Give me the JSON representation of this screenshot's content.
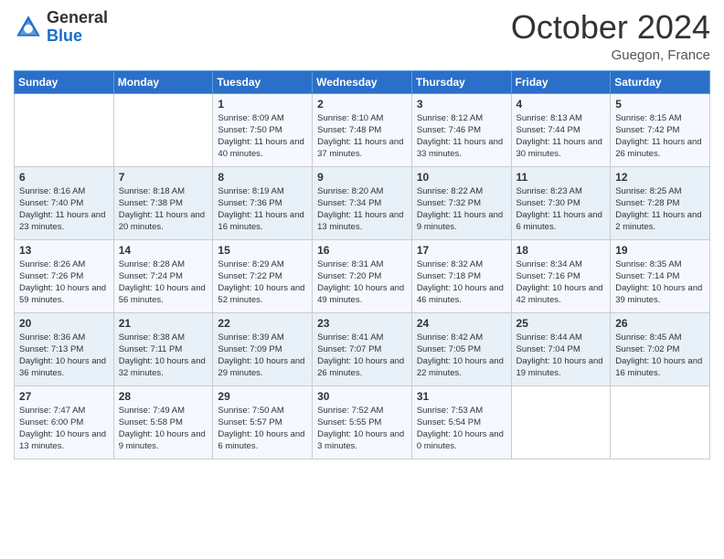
{
  "logo": {
    "general": "General",
    "blue": "Blue"
  },
  "title": "October 2024",
  "location": "Guegon, France",
  "days_of_week": [
    "Sunday",
    "Monday",
    "Tuesday",
    "Wednesday",
    "Thursday",
    "Friday",
    "Saturday"
  ],
  "weeks": [
    [
      {
        "day": "",
        "sunrise": "",
        "sunset": "",
        "daylight": ""
      },
      {
        "day": "",
        "sunrise": "",
        "sunset": "",
        "daylight": ""
      },
      {
        "day": "1",
        "sunrise": "Sunrise: 8:09 AM",
        "sunset": "Sunset: 7:50 PM",
        "daylight": "Daylight: 11 hours and 40 minutes."
      },
      {
        "day": "2",
        "sunrise": "Sunrise: 8:10 AM",
        "sunset": "Sunset: 7:48 PM",
        "daylight": "Daylight: 11 hours and 37 minutes."
      },
      {
        "day": "3",
        "sunrise": "Sunrise: 8:12 AM",
        "sunset": "Sunset: 7:46 PM",
        "daylight": "Daylight: 11 hours and 33 minutes."
      },
      {
        "day": "4",
        "sunrise": "Sunrise: 8:13 AM",
        "sunset": "Sunset: 7:44 PM",
        "daylight": "Daylight: 11 hours and 30 minutes."
      },
      {
        "day": "5",
        "sunrise": "Sunrise: 8:15 AM",
        "sunset": "Sunset: 7:42 PM",
        "daylight": "Daylight: 11 hours and 26 minutes."
      }
    ],
    [
      {
        "day": "6",
        "sunrise": "Sunrise: 8:16 AM",
        "sunset": "Sunset: 7:40 PM",
        "daylight": "Daylight: 11 hours and 23 minutes."
      },
      {
        "day": "7",
        "sunrise": "Sunrise: 8:18 AM",
        "sunset": "Sunset: 7:38 PM",
        "daylight": "Daylight: 11 hours and 20 minutes."
      },
      {
        "day": "8",
        "sunrise": "Sunrise: 8:19 AM",
        "sunset": "Sunset: 7:36 PM",
        "daylight": "Daylight: 11 hours and 16 minutes."
      },
      {
        "day": "9",
        "sunrise": "Sunrise: 8:20 AM",
        "sunset": "Sunset: 7:34 PM",
        "daylight": "Daylight: 11 hours and 13 minutes."
      },
      {
        "day": "10",
        "sunrise": "Sunrise: 8:22 AM",
        "sunset": "Sunset: 7:32 PM",
        "daylight": "Daylight: 11 hours and 9 minutes."
      },
      {
        "day": "11",
        "sunrise": "Sunrise: 8:23 AM",
        "sunset": "Sunset: 7:30 PM",
        "daylight": "Daylight: 11 hours and 6 minutes."
      },
      {
        "day": "12",
        "sunrise": "Sunrise: 8:25 AM",
        "sunset": "Sunset: 7:28 PM",
        "daylight": "Daylight: 11 hours and 2 minutes."
      }
    ],
    [
      {
        "day": "13",
        "sunrise": "Sunrise: 8:26 AM",
        "sunset": "Sunset: 7:26 PM",
        "daylight": "Daylight: 10 hours and 59 minutes."
      },
      {
        "day": "14",
        "sunrise": "Sunrise: 8:28 AM",
        "sunset": "Sunset: 7:24 PM",
        "daylight": "Daylight: 10 hours and 56 minutes."
      },
      {
        "day": "15",
        "sunrise": "Sunrise: 8:29 AM",
        "sunset": "Sunset: 7:22 PM",
        "daylight": "Daylight: 10 hours and 52 minutes."
      },
      {
        "day": "16",
        "sunrise": "Sunrise: 8:31 AM",
        "sunset": "Sunset: 7:20 PM",
        "daylight": "Daylight: 10 hours and 49 minutes."
      },
      {
        "day": "17",
        "sunrise": "Sunrise: 8:32 AM",
        "sunset": "Sunset: 7:18 PM",
        "daylight": "Daylight: 10 hours and 46 minutes."
      },
      {
        "day": "18",
        "sunrise": "Sunrise: 8:34 AM",
        "sunset": "Sunset: 7:16 PM",
        "daylight": "Daylight: 10 hours and 42 minutes."
      },
      {
        "day": "19",
        "sunrise": "Sunrise: 8:35 AM",
        "sunset": "Sunset: 7:14 PM",
        "daylight": "Daylight: 10 hours and 39 minutes."
      }
    ],
    [
      {
        "day": "20",
        "sunrise": "Sunrise: 8:36 AM",
        "sunset": "Sunset: 7:13 PM",
        "daylight": "Daylight: 10 hours and 36 minutes."
      },
      {
        "day": "21",
        "sunrise": "Sunrise: 8:38 AM",
        "sunset": "Sunset: 7:11 PM",
        "daylight": "Daylight: 10 hours and 32 minutes."
      },
      {
        "day": "22",
        "sunrise": "Sunrise: 8:39 AM",
        "sunset": "Sunset: 7:09 PM",
        "daylight": "Daylight: 10 hours and 29 minutes."
      },
      {
        "day": "23",
        "sunrise": "Sunrise: 8:41 AM",
        "sunset": "Sunset: 7:07 PM",
        "daylight": "Daylight: 10 hours and 26 minutes."
      },
      {
        "day": "24",
        "sunrise": "Sunrise: 8:42 AM",
        "sunset": "Sunset: 7:05 PM",
        "daylight": "Daylight: 10 hours and 22 minutes."
      },
      {
        "day": "25",
        "sunrise": "Sunrise: 8:44 AM",
        "sunset": "Sunset: 7:04 PM",
        "daylight": "Daylight: 10 hours and 19 minutes."
      },
      {
        "day": "26",
        "sunrise": "Sunrise: 8:45 AM",
        "sunset": "Sunset: 7:02 PM",
        "daylight": "Daylight: 10 hours and 16 minutes."
      }
    ],
    [
      {
        "day": "27",
        "sunrise": "Sunrise: 7:47 AM",
        "sunset": "Sunset: 6:00 PM",
        "daylight": "Daylight: 10 hours and 13 minutes."
      },
      {
        "day": "28",
        "sunrise": "Sunrise: 7:49 AM",
        "sunset": "Sunset: 5:58 PM",
        "daylight": "Daylight: 10 hours and 9 minutes."
      },
      {
        "day": "29",
        "sunrise": "Sunrise: 7:50 AM",
        "sunset": "Sunset: 5:57 PM",
        "daylight": "Daylight: 10 hours and 6 minutes."
      },
      {
        "day": "30",
        "sunrise": "Sunrise: 7:52 AM",
        "sunset": "Sunset: 5:55 PM",
        "daylight": "Daylight: 10 hours and 3 minutes."
      },
      {
        "day": "31",
        "sunrise": "Sunrise: 7:53 AM",
        "sunset": "Sunset: 5:54 PM",
        "daylight": "Daylight: 10 hours and 0 minutes."
      },
      {
        "day": "",
        "sunrise": "",
        "sunset": "",
        "daylight": ""
      },
      {
        "day": "",
        "sunrise": "",
        "sunset": "",
        "daylight": ""
      }
    ]
  ]
}
